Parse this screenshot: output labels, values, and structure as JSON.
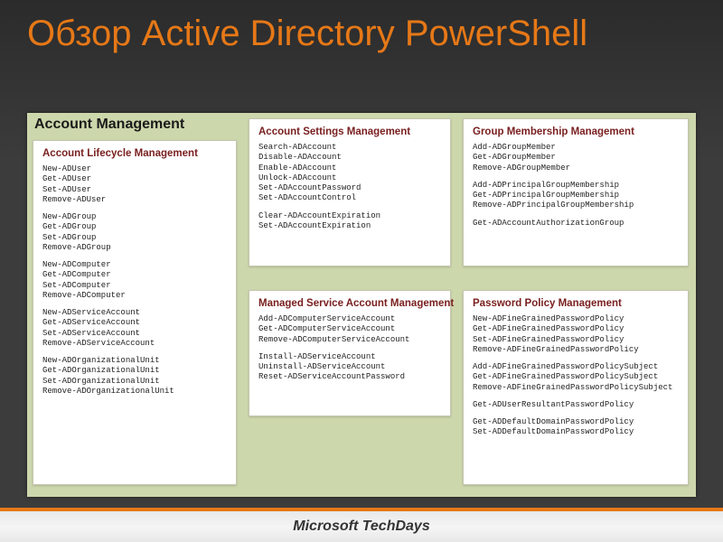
{
  "title": "Обзор Active Directory PowerShell",
  "stage_title": "Account Management",
  "footer": "Microsoft TechDays",
  "cards": {
    "lifecycle": {
      "title": "Account Lifecycle Management",
      "groups": [
        [
          "New-ADUser",
          "Get-ADUser",
          "Set-ADUser",
          "Remove-ADUser"
        ],
        [
          "New-ADGroup",
          "Get-ADGroup",
          "Set-ADGroup",
          "Remove-ADGroup"
        ],
        [
          "New-ADComputer",
          "Get-ADComputer",
          "Set-ADComputer",
          "Remove-ADComputer"
        ],
        [
          "New-ADServiceAccount",
          "Get-ADServiceAccount",
          "Set-ADServiceAccount",
          "Remove-ADServiceAccount"
        ],
        [
          "New-ADOrganizationalUnit",
          "Get-ADOrganizationalUnit",
          "Set-ADOrganizationalUnit",
          "Remove-ADOrganizationalUnit"
        ]
      ]
    },
    "settings": {
      "title": "Account Settings Management",
      "groups": [
        [
          "Search-ADAccount",
          "Disable-ADAccount",
          "Enable-ADAccount",
          "Unlock-ADAccount",
          "Set-ADAccountPassword",
          "Set-ADAccountControl"
        ],
        [
          "Clear-ADAccountExpiration",
          "Set-ADAccountExpiration"
        ]
      ]
    },
    "managed": {
      "title": "Managed Service Account Management",
      "groups": [
        [
          "Add-ADComputerServiceAccount",
          "Get-ADComputerServiceAccount",
          "Remove-ADComputerServiceAccount"
        ],
        [
          "Install-ADServiceAccount",
          "Uninstall-ADServiceAccount",
          "Reset-ADServiceAccountPassword"
        ]
      ]
    },
    "group": {
      "title": "Group Membership Management",
      "groups": [
        [
          "Add-ADGroupMember",
          "Get-ADGroupMember",
          "Remove-ADGroupMember"
        ],
        [
          "Add-ADPrincipalGroupMembership",
          "Get-ADPrincipalGroupMembership",
          "Remove-ADPrincipalGroupMembership"
        ],
        [
          "Get-ADAccountAuthorizationGroup"
        ]
      ]
    },
    "password": {
      "title": "Password Policy Management",
      "groups": [
        [
          "New-ADFineGrainedPasswordPolicy",
          "Get-ADFineGrainedPasswordPolicy",
          "Set-ADFineGrainedPasswordPolicy",
          "Remove-ADFineGrainedPasswordPolicy"
        ],
        [
          "Add-ADFineGrainedPasswordPolicySubject",
          "Get-ADFineGrainedPasswordPolicySubject",
          "Remove-ADFineGrainedPasswordPolicySubject"
        ],
        [
          "Get-ADUserResultantPasswordPolicy"
        ],
        [
          "Get-ADDefaultDomainPasswordPolicy",
          "Set-ADDefaultDomainPasswordPolicy"
        ]
      ]
    }
  }
}
